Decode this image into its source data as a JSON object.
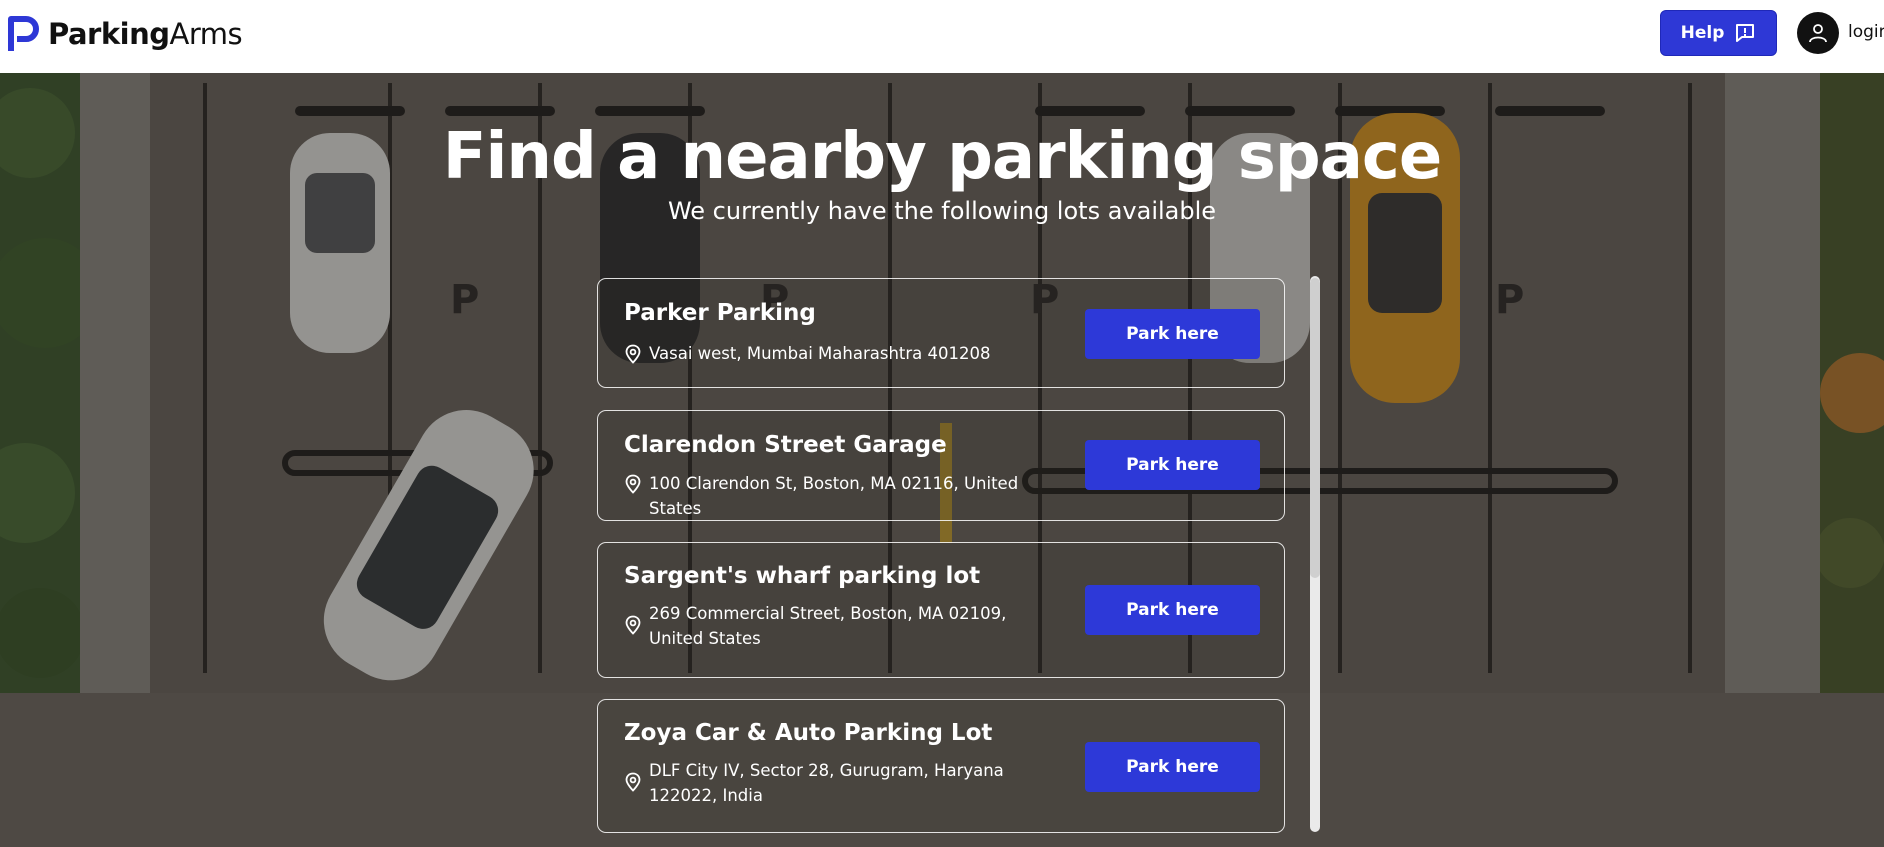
{
  "app": {
    "logo_bold": "Parking",
    "logo_light": "Arms"
  },
  "header": {
    "help_label": "Help",
    "login_label": "login"
  },
  "hero": {
    "title": "Find a nearby parking space",
    "subtitle": "We currently have the following lots available"
  },
  "lots": [
    {
      "name": "Parker Parking",
      "address": "Vasai west, Mumbai Maharashtra 401208",
      "button": "Park here"
    },
    {
      "name": "Clarendon Street Garage",
      "address": "100 Clarendon St, Boston, MA 02116, United States",
      "button": "Park here"
    },
    {
      "name": "Sargent's wharf parking lot",
      "address": "269 Commercial Street, Boston, MA 02109, United States",
      "button": "Park here"
    },
    {
      "name": "Zoya Car & Auto Parking Lot",
      "address": "DLF City IV, Sector 28, Gurugram, Haryana 122022, India",
      "button": "Park here"
    }
  ],
  "icons": {
    "logo": "parkingarms-logo",
    "help": "feedback-icon",
    "user": "user-icon",
    "pin": "location-pin-icon"
  },
  "colors": {
    "accent": "#2e38d6",
    "header_bg": "#ffffff"
  }
}
